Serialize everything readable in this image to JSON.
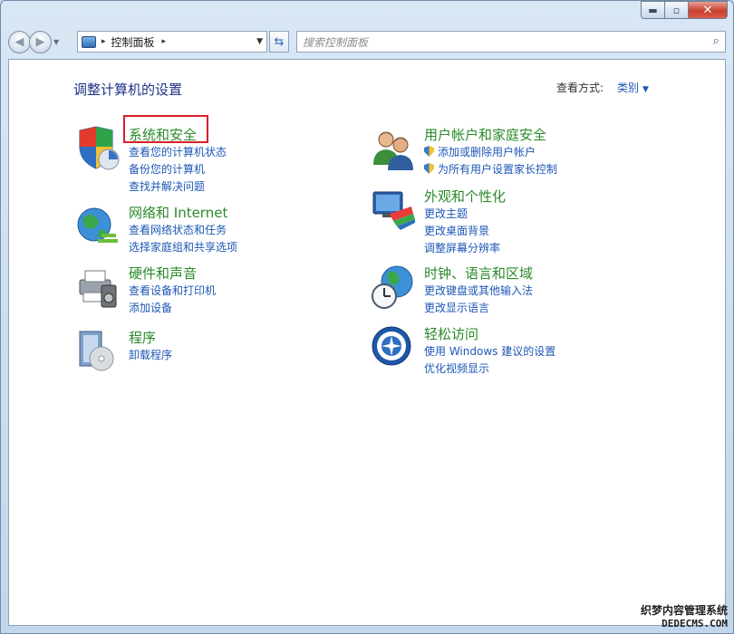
{
  "window": {
    "controls": {
      "minimize": "▬",
      "maximize": "▫",
      "close": "✕"
    }
  },
  "navbar": {
    "back_icon": "back-arrow-icon",
    "forward_icon": "forward-arrow-icon",
    "address": {
      "segment": "控制面板",
      "separator": "▸"
    },
    "search": {
      "placeholder": "搜索控制面板"
    }
  },
  "header": {
    "title": "调整计算机的设置",
    "view_by_label": "查看方式:",
    "view_by_value": "类别"
  },
  "categories": [
    {
      "title": "系统和安全",
      "icon": "security-shield-icon",
      "links": [
        "查看您的计算机状态",
        "备份您的计算机",
        "查找并解决问题"
      ]
    },
    {
      "title": "网络和 Internet",
      "icon": "network-globe-icon",
      "links": [
        "查看网络状态和任务",
        "选择家庭组和共享选项"
      ]
    },
    {
      "title": "硬件和声音",
      "icon": "printer-speaker-icon",
      "links": [
        "查看设备和打印机",
        "添加设备"
      ]
    },
    {
      "title": "程序",
      "icon": "programs-disc-icon",
      "links": [
        "卸载程序"
      ]
    },
    {
      "title": "用户帐户和家庭安全",
      "icon": "users-icon",
      "links": [
        "添加或删除用户帐户",
        "为所有用户设置家长控制"
      ]
    },
    {
      "title": "外观和个性化",
      "icon": "monitor-palette-icon",
      "links": [
        "更改主题",
        "更改桌面背景",
        "调整屏幕分辨率"
      ]
    },
    {
      "title": "时钟、语言和区域",
      "icon": "globe-clock-icon",
      "links": [
        "更改键盘或其他输入法",
        "更改显示语言"
      ]
    },
    {
      "title": "轻松访问",
      "icon": "ease-of-access-icon",
      "links": [
        "使用 Windows 建议的设置",
        "优化视频显示"
      ]
    }
  ],
  "watermark": {
    "line1": "织梦内容管理系统",
    "line2": "DEDECMS.COM"
  },
  "colors": {
    "category_title": "#2a8a2a",
    "link": "#1e57b5",
    "page_title": "#1e3287",
    "highlight": "#d91f26"
  }
}
